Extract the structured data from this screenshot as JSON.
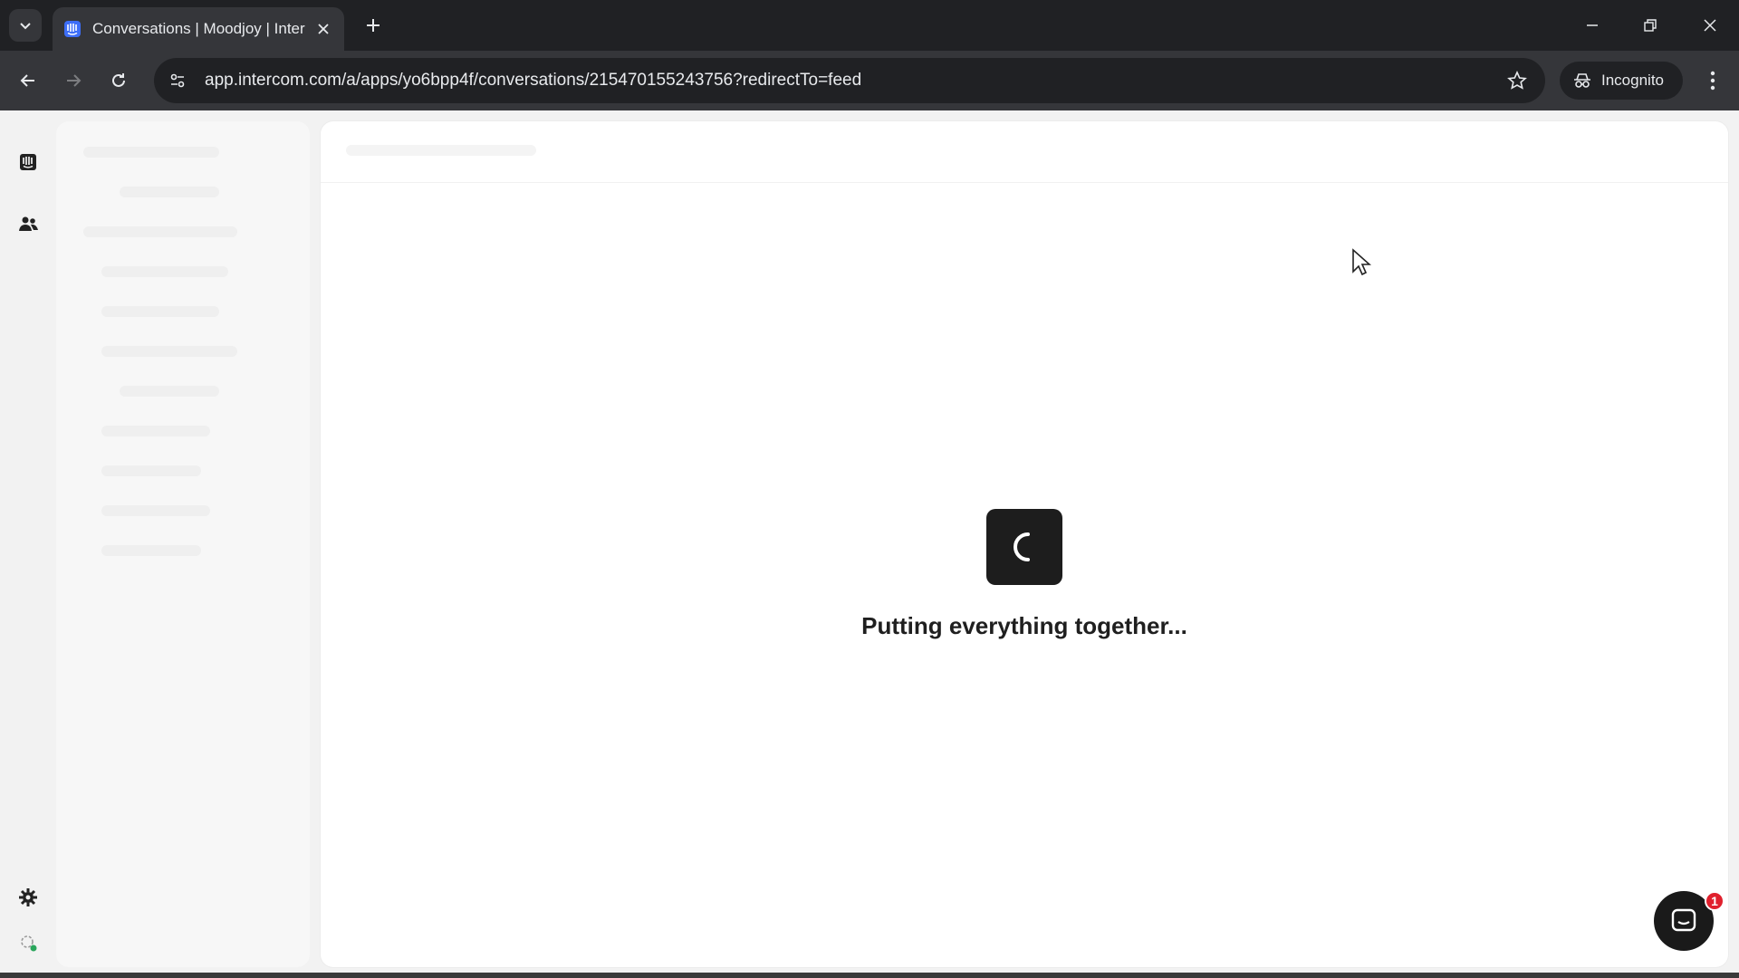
{
  "browser": {
    "tab": {
      "title": "Conversations | Moodjoy | Inter",
      "favicon": "intercom-logo-icon"
    },
    "url": "app.intercom.com/a/apps/yo6bpp4f/conversations/215470155243756?redirectTo=feed",
    "incognito_label": "Incognito"
  },
  "app": {
    "rail_icons": [
      "inbox-icon",
      "contacts-icon",
      "settings-icon",
      "status-icon"
    ],
    "loading_text": "Putting everything together...",
    "messenger_badge": "1"
  },
  "colors": {
    "chrome_dark": "#202124",
    "chrome_toolbar": "#35363a",
    "loader_box": "#1d1d1d",
    "badge_red": "#e0202d"
  }
}
